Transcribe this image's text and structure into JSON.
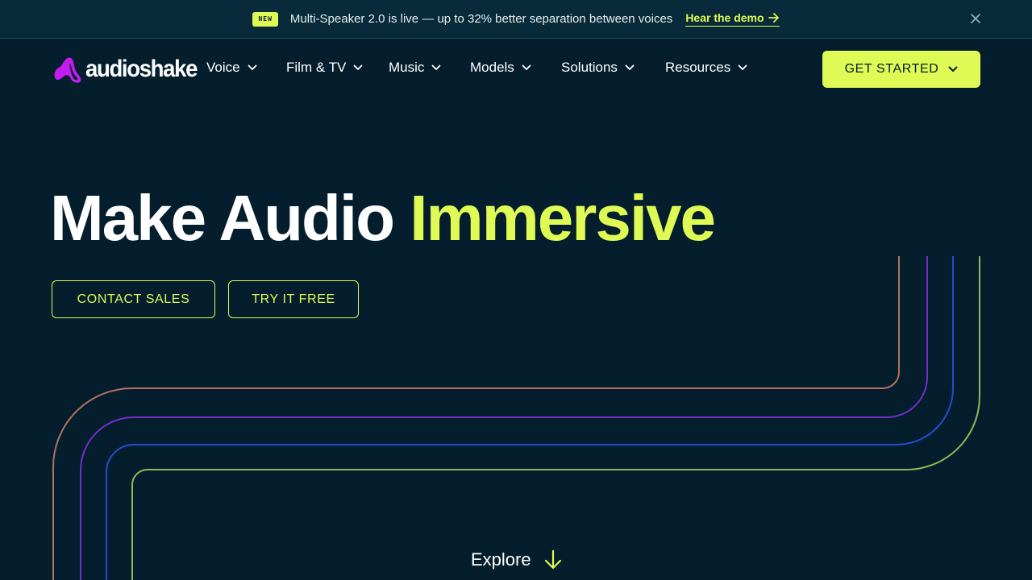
{
  "announcement": {
    "badge": "NEW",
    "message": "Multi-Speaker 2.0 is live — up to 32% better separation between voices",
    "link_label": "Hear the demo",
    "link_icon": "arrow-right-icon",
    "close_icon": "close-icon"
  },
  "brand": {
    "name": "audioshake",
    "logo_color": "#c21cf0"
  },
  "nav": {
    "items": [
      {
        "label": "Voice"
      },
      {
        "label": "Film & TV"
      },
      {
        "label": "Music"
      },
      {
        "label": "Models"
      },
      {
        "label": "Solutions"
      },
      {
        "label": "Resources"
      }
    ],
    "cta_label": "GET STARTED"
  },
  "hero": {
    "title_main": "Make Audio",
    "title_accent": "Immersive",
    "contact_label": "CONTACT SALES",
    "try_label": "TRY IT FREE"
  },
  "explore": {
    "label": "Explore"
  },
  "colors": {
    "background": "#041e2d",
    "accent": "#dffa55",
    "line_orange": "#c97a64",
    "line_purple": "#7a2fd6",
    "line_blue": "#2a4fd8",
    "line_green": "#a9c65a"
  }
}
